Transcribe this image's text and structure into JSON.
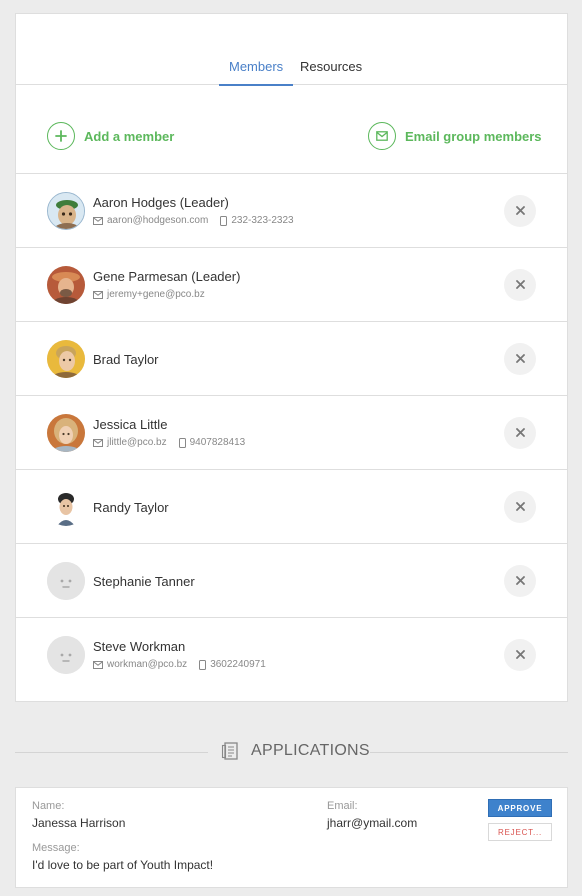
{
  "tabs": [
    {
      "label": "Members",
      "active": true
    },
    {
      "label": "Resources",
      "active": false
    }
  ],
  "actions": {
    "add_member": {
      "label": "Add a member",
      "icon": "plus-icon"
    },
    "email_group": {
      "label": "Email group members",
      "icon": "envelope-icon"
    }
  },
  "accent": "#4a80c8",
  "action_color": "#5cb85c",
  "members": [
    {
      "name": "Aaron Hodges (Leader)",
      "email": "aaron@hodgeson.com",
      "phone": "232-323-2323",
      "avatar": "photo"
    },
    {
      "name": "Gene Parmesan (Leader)",
      "email": "jeremy+gene@pco.bz",
      "phone": "",
      "avatar": "photo"
    },
    {
      "name": "Brad Taylor",
      "email": "",
      "phone": "",
      "avatar": "photo"
    },
    {
      "name": "Jessica Little",
      "email": "jlittle@pco.bz",
      "phone": "9407828413",
      "avatar": "photo"
    },
    {
      "name": "Randy Taylor",
      "email": "",
      "phone": "",
      "avatar": "photo"
    },
    {
      "name": "Stephanie Tanner",
      "email": "",
      "phone": "",
      "avatar": "placeholder"
    },
    {
      "name": "Steve Workman",
      "email": "workman@pco.bz",
      "phone": "3602240971",
      "avatar": "placeholder"
    }
  ],
  "applications": {
    "title": "APPLICATIONS",
    "icon": "document-icon",
    "items": [
      {
        "name_label": "Name:",
        "name": "Janessa Harrison",
        "email_label": "Email:",
        "email": "jharr@ymail.com",
        "message_label": "Message:",
        "message": "I'd love to be part of Youth Impact!",
        "approve_label": "APPROVE",
        "reject_label": "REJECT..."
      }
    ]
  }
}
